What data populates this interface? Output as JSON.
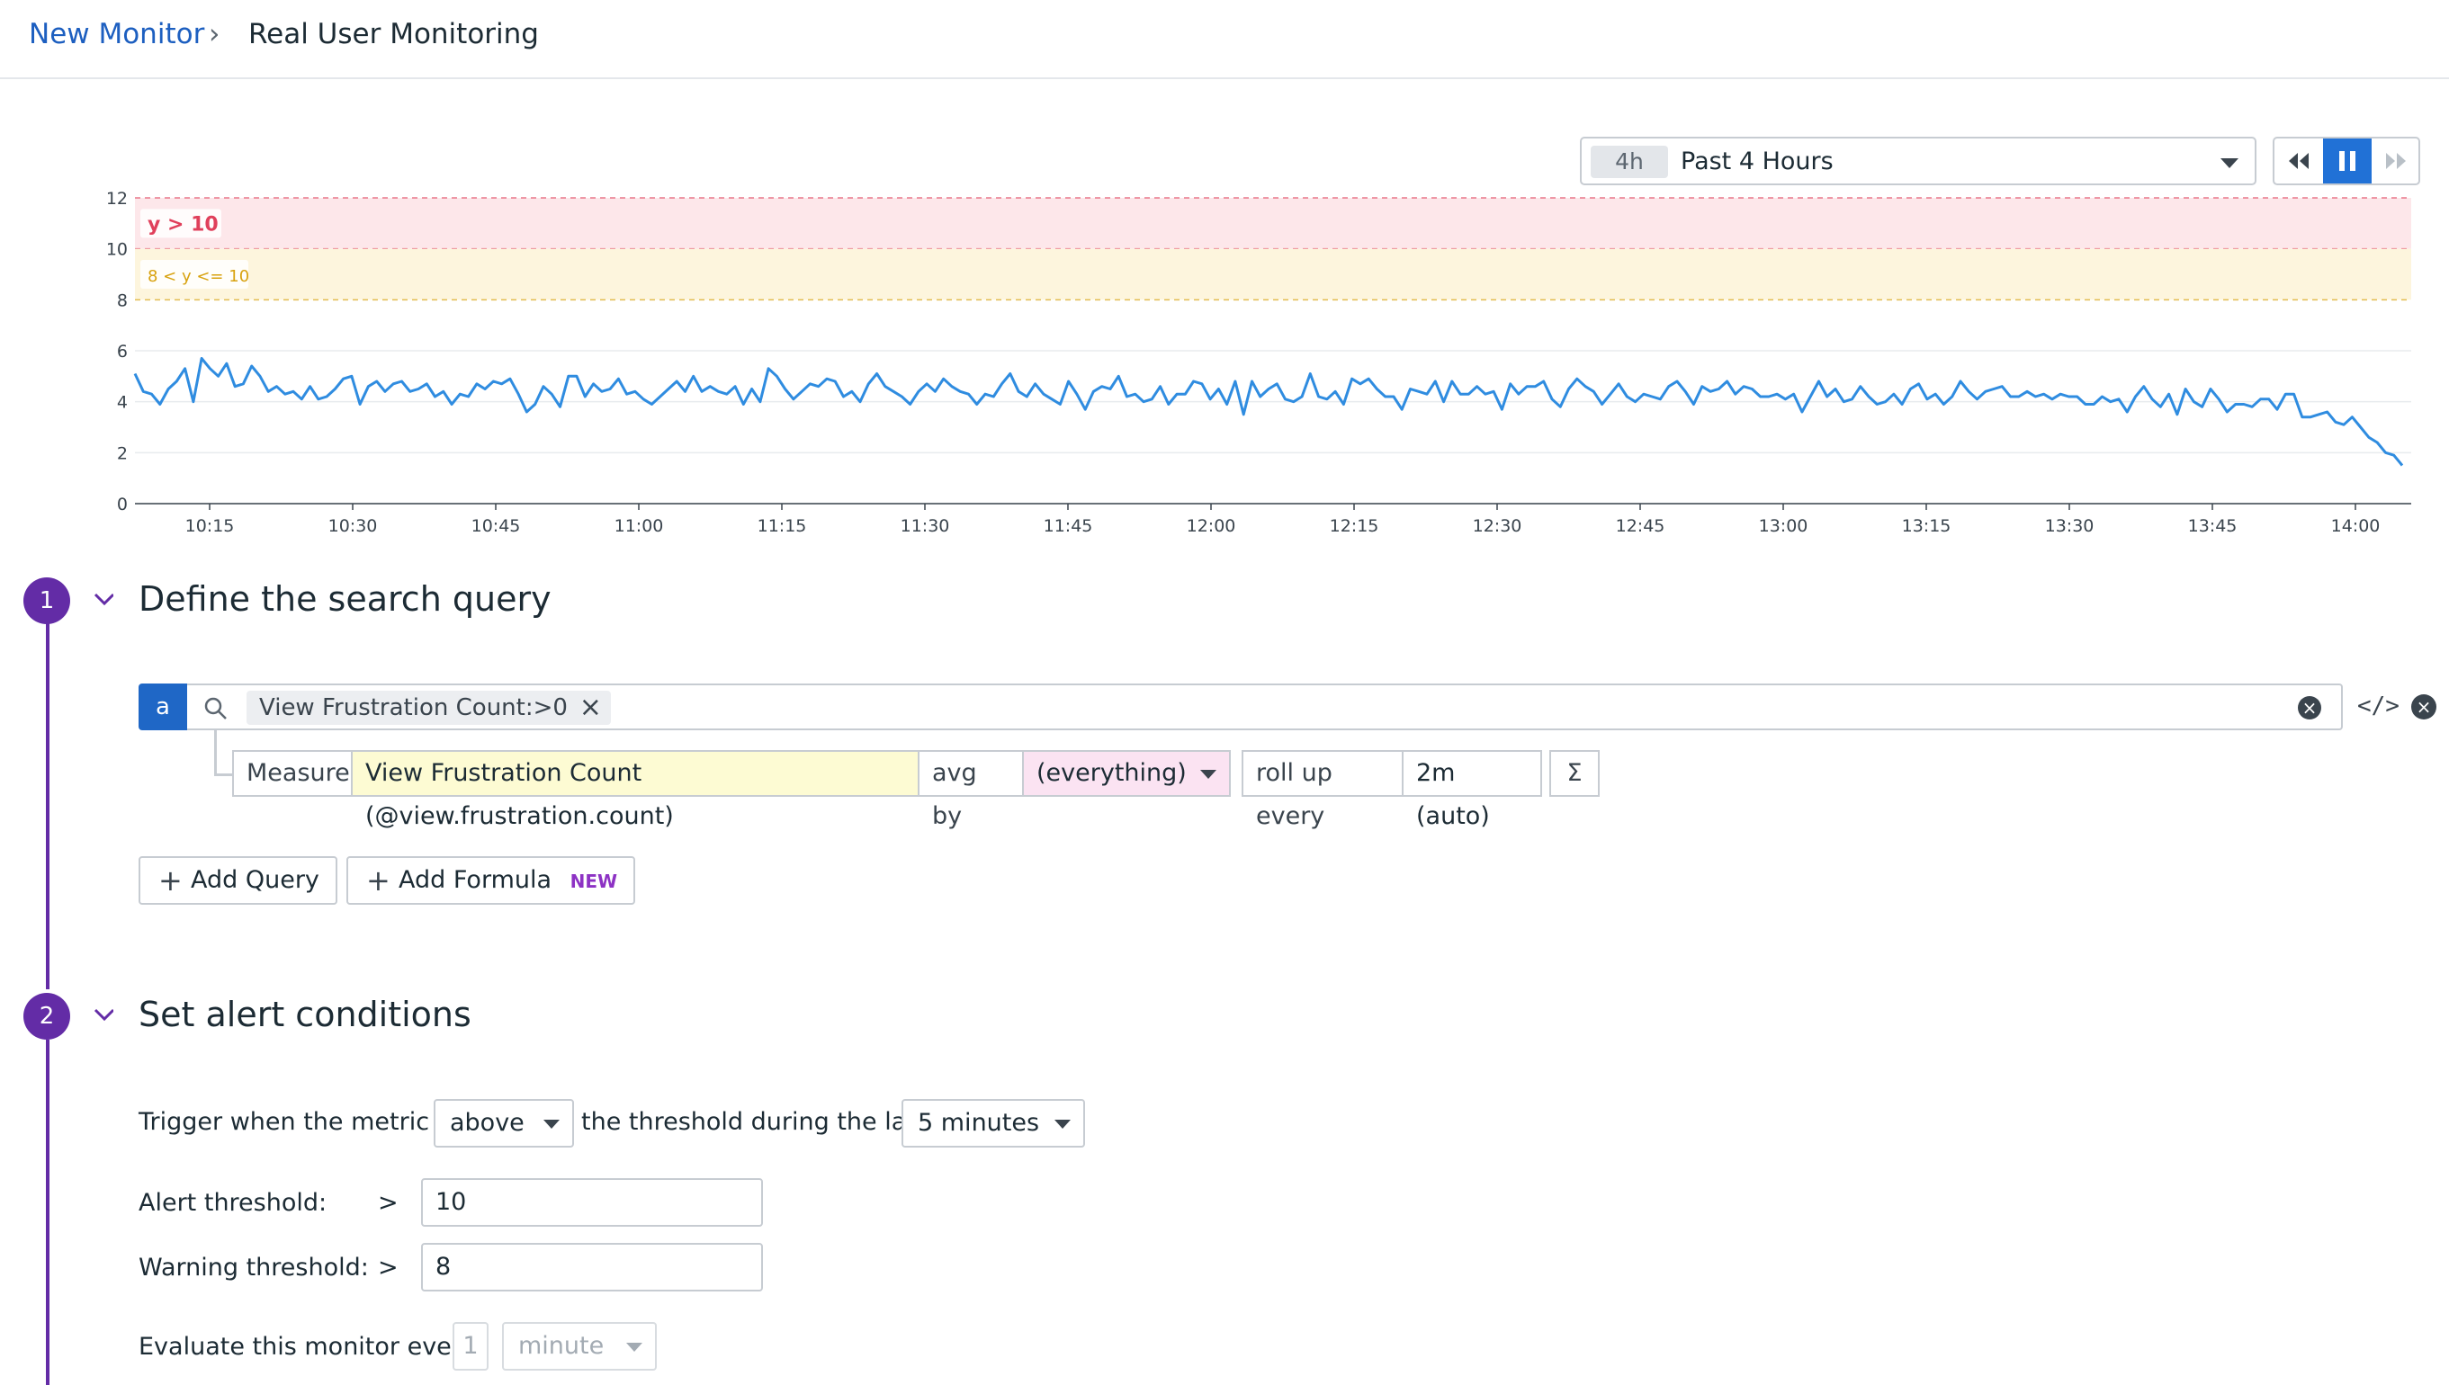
{
  "breadcrumb": {
    "parent": "New Monitor",
    "separator": "›",
    "current": "Real User Monitoring"
  },
  "time_selector": {
    "badge": "4h",
    "label": "Past 4 Hours"
  },
  "playback": {
    "rewind": "rewind-icon",
    "pause": "pause-icon",
    "forward": "fast-forward-icon",
    "active_color": "#2171d6"
  },
  "chart_data": {
    "type": "line",
    "yticks": [
      "0",
      "2",
      "4",
      "6",
      "8",
      "10",
      "12"
    ],
    "ylim": [
      0,
      12
    ],
    "xticks": [
      "10:15",
      "10:30",
      "10:45",
      "11:00",
      "11:15",
      "11:30",
      "11:45",
      "12:00",
      "12:15",
      "12:30",
      "12:45",
      "13:00",
      "13:15",
      "13:30",
      "13:45",
      "14:00"
    ],
    "bands": [
      {
        "label": "y > 10",
        "from": 10,
        "to": 12,
        "color": "#fde7ea",
        "text_color": "#e0405b"
      },
      {
        "label": "8 < y <= 10",
        "from": 8,
        "to": 10,
        "color": "#fdf5dd",
        "text_color": "#d8a20f"
      }
    ],
    "series": [
      {
        "color": "#2f8ce0",
        "values": [
          5.1,
          4.4,
          4.3,
          3.9,
          4.5,
          4.8,
          5.3,
          4.0,
          5.7,
          5.3,
          5.0,
          5.5,
          4.6,
          4.7,
          5.4,
          5.0,
          4.4,
          4.6,
          4.3,
          4.4,
          4.1,
          4.6,
          4.1,
          4.2,
          4.5,
          4.9,
          5.0,
          3.9,
          4.6,
          4.8,
          4.4,
          4.7,
          4.8,
          4.4,
          4.5,
          4.7,
          4.2,
          4.4,
          3.9,
          4.3,
          4.2,
          4.7,
          4.5,
          4.8,
          4.7,
          4.9,
          4.3,
          3.6,
          3.9,
          4.6,
          4.3,
          3.8,
          5.0,
          5.0,
          4.2,
          4.7,
          4.4,
          4.5,
          4.9,
          4.3,
          4.4,
          4.1,
          3.9,
          4.2,
          4.5,
          4.8,
          4.4,
          5.0,
          4.4,
          4.6,
          4.4,
          4.3,
          4.6,
          3.9,
          4.5,
          4.0,
          5.3,
          5.0,
          4.5,
          4.1,
          4.4,
          4.7,
          4.6,
          4.9,
          4.8,
          4.2,
          4.4,
          4.0,
          4.7,
          5.1,
          4.6,
          4.4,
          4.2,
          3.9,
          4.4,
          4.7,
          4.4,
          4.9,
          4.6,
          4.4,
          4.3,
          3.9,
          4.3,
          4.2,
          4.7,
          5.1,
          4.4,
          4.2,
          4.7,
          4.3,
          4.1,
          3.9,
          4.8,
          4.3,
          3.7,
          4.4,
          4.6,
          4.5,
          5.0,
          4.2,
          4.3,
          4.0,
          4.1,
          4.6,
          3.9,
          4.3,
          4.3,
          4.8,
          4.7,
          4.1,
          4.5,
          3.9,
          4.8,
          3.5,
          4.8,
          4.2,
          4.5,
          4.7,
          4.1,
          4.0,
          4.2,
          5.1,
          4.2,
          4.1,
          4.4,
          3.9,
          4.9,
          4.7,
          4.9,
          4.5,
          4.2,
          4.2,
          3.7,
          4.5,
          4.4,
          4.3,
          4.8,
          4.0,
          4.8,
          4.3,
          4.3,
          4.6,
          4.3,
          4.4,
          3.7,
          4.7,
          4.3,
          4.6,
          4.6,
          4.8,
          4.1,
          3.8,
          4.5,
          4.9,
          4.6,
          4.4,
          3.9,
          4.3,
          4.7,
          4.2,
          4.0,
          4.3,
          4.2,
          4.1,
          4.6,
          4.8,
          4.4,
          3.9,
          4.6,
          4.4,
          4.5,
          4.8,
          4.3,
          4.6,
          4.5,
          4.2,
          4.2,
          4.3,
          4.1,
          4.3,
          3.6,
          4.2,
          4.8,
          4.2,
          4.5,
          4.0,
          4.1,
          4.6,
          4.2,
          3.9,
          4.0,
          4.3,
          3.9,
          4.5,
          4.7,
          4.1,
          4.3,
          3.9,
          4.2,
          4.8,
          4.4,
          4.1,
          4.4,
          4.5,
          4.6,
          4.2,
          4.2,
          4.4,
          4.2,
          4.3,
          4.1,
          4.3,
          4.2,
          4.2,
          3.9,
          3.9,
          4.2,
          4.0,
          4.1,
          3.6,
          4.2,
          4.6,
          4.1,
          3.8,
          4.3,
          3.5,
          4.5,
          4.0,
          3.8,
          4.5,
          4.1,
          3.6,
          3.9,
          3.9,
          3.8,
          4.1,
          4.1,
          3.7,
          4.3,
          4.3,
          3.4,
          3.4,
          3.5,
          3.6,
          3.2,
          3.1,
          3.4,
          3.0,
          2.6,
          2.4,
          2.0,
          1.9,
          1.5
        ]
      }
    ]
  },
  "steps": [
    {
      "number": "1",
      "title": "Define the search query"
    },
    {
      "number": "2",
      "title": "Set alert conditions"
    }
  ],
  "query": {
    "letter": "a",
    "filter": "View Frustration Count:>0",
    "measure_label": "Measure",
    "measure_value": "View Frustration Count (@view.frustration.count)",
    "agg_label": "avg by",
    "group_value": "(everything)",
    "rollup_label": "roll up every",
    "rollup_value": "2m (auto)",
    "sigma": "Σ",
    "code_icon": "</>"
  },
  "buttons": {
    "add_query": "Add Query",
    "add_formula": "Add Formula",
    "new_badge": "NEW"
  },
  "alert": {
    "trigger_prefix": "Trigger when the metric is",
    "trigger_op": "above",
    "trigger_mid": "the threshold during the last",
    "trigger_window": "5 minutes",
    "alert_label": "Alert threshold:",
    "alert_op": ">",
    "alert_value": "10",
    "warning_label": "Warning threshold:",
    "warning_op": ">",
    "warning_value": "8",
    "evaluate_label": "Evaluate this monitor every",
    "evaluate_value": "1",
    "evaluate_unit": "minute"
  }
}
